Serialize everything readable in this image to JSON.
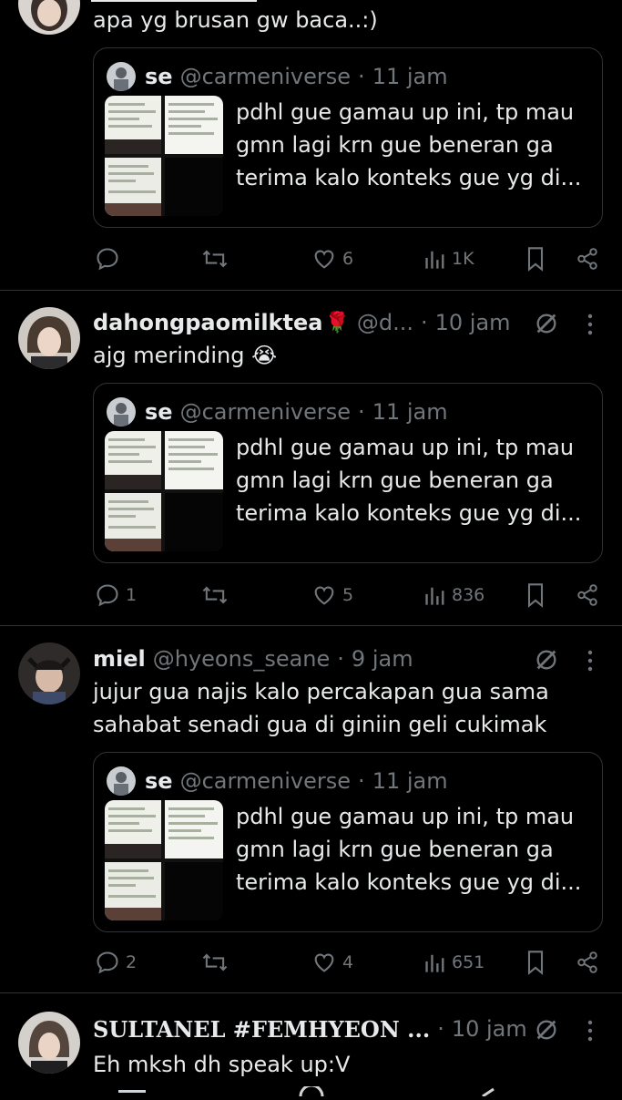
{
  "posts": [
    {
      "name": "",
      "handle": "",
      "time": "",
      "text": "apa yg brusan gw baca..:)",
      "quote": {
        "name": "se",
        "handle": "@carmeniverse",
        "time": "11 jam",
        "text": "pdhl gue gamau up ini, tp mau gmn lagi krn gue beneran ga terima kalo konteks gue yg di..."
      },
      "stats": {
        "replies": "",
        "likes": "6",
        "views": "1K"
      }
    },
    {
      "name": "dahongpaomilktea",
      "handle": "@d...",
      "time": "10 jam",
      "text": "ajg merinding 😭",
      "quote": {
        "name": "se",
        "handle": "@carmeniverse",
        "time": "11 jam",
        "text": "pdhl gue gamau up ini, tp mau gmn lagi krn gue beneran ga terima kalo konteks gue yg di..."
      },
      "stats": {
        "replies": "1",
        "likes": "5",
        "views": "836"
      }
    },
    {
      "name": "miel",
      "handle": "@hyeons_seane",
      "time": "9 jam",
      "text": "jujur gua najis kalo percakapan gua sama sahabat senadi gua di giniin geli cukimak",
      "quote": {
        "name": "se",
        "handle": "@carmeniverse",
        "time": "11 jam",
        "text": "pdhl gue gamau up ini, tp mau gmn lagi krn gue beneran ga terima kalo konteks gue yg di..."
      },
      "stats": {
        "replies": "2",
        "likes": "4",
        "views": "651"
      }
    },
    {
      "name": "SULTANEL #FEMHYEON ...",
      "handle": "",
      "time": "10 jam",
      "text": "Eh mksh dh speak up:V"
    }
  ],
  "separator": "·",
  "colors": {
    "background": "#000000",
    "text": "#e7e9ea",
    "muted": "#71767b",
    "divider": "#2f3336"
  },
  "icons": [
    "reply-icon",
    "retweet-icon",
    "like-icon",
    "views-icon",
    "bookmark-icon",
    "share-icon",
    "grok-icon",
    "more-icon",
    "rose-emoji"
  ]
}
